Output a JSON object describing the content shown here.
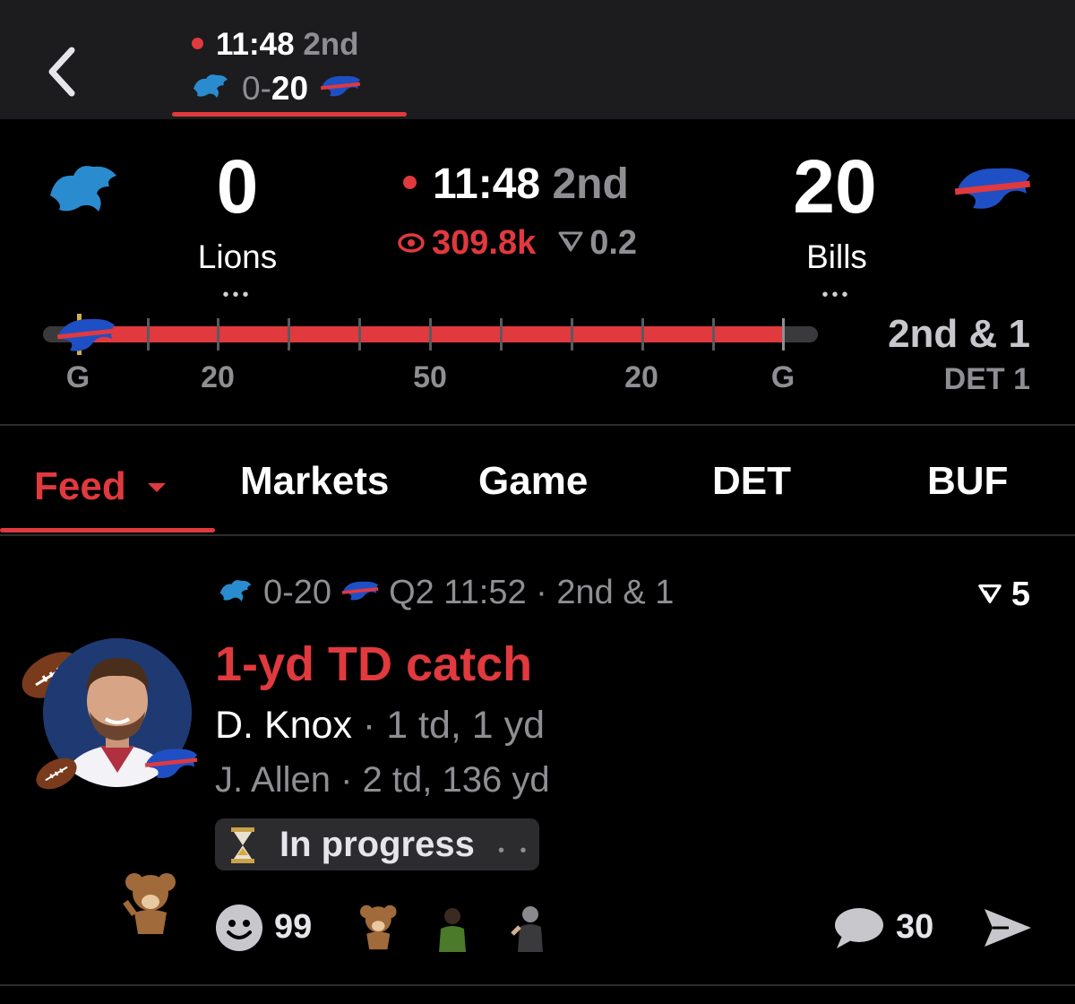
{
  "header": {
    "clock": "11:48",
    "period": "2nd",
    "score_home": "0",
    "score_sep": "-",
    "score_away": "20"
  },
  "scoreboard": {
    "home": {
      "score": "0",
      "name": "Lions",
      "logo": "lions-logo"
    },
    "away": {
      "score": "20",
      "name": "Bills",
      "logo": "bills-logo"
    },
    "clock": "11:48",
    "period": "2nd",
    "viewers": "309.8k",
    "likes": "0.2",
    "more": "•••"
  },
  "field": {
    "yard_labels": [
      "G",
      "20",
      "50",
      "20",
      "G"
    ],
    "down_distance": "2nd & 1",
    "spot": "DET 1",
    "ball_position_fraction": 0.01
  },
  "tabs": [
    {
      "label": "Feed",
      "active": true
    },
    {
      "label": "Markets"
    },
    {
      "label": "Game"
    },
    {
      "label": "DET"
    },
    {
      "label": "BUF"
    }
  ],
  "post": {
    "score": "0-20",
    "time": "Q2 11:52 · 2nd & 1",
    "likes": "5",
    "headline": "1-yd TD catch",
    "stat_primary_name": "D. Knox",
    "stat_primary_line": "· 1 td, 1 yd",
    "stat_secondary_name": "J. Allen",
    "stat_secondary_line": "· 2 td, 136 yd",
    "status": "In progress",
    "reaction_count": "99",
    "comment_count": "30"
  },
  "colors": {
    "accent": "#e0393e",
    "lions_blue": "#2a8ccf",
    "bills_blue": "#1f4fc4",
    "bills_red": "#e0393e"
  }
}
